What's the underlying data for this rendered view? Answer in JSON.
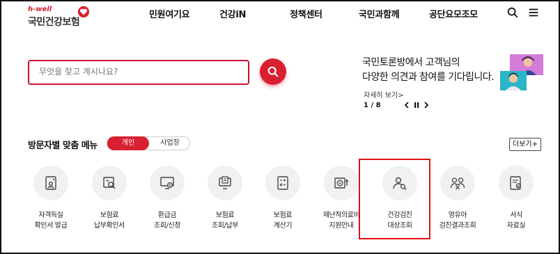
{
  "header": {
    "logo_small": "h-well",
    "logo_name": "국민건강보험",
    "nav": [
      "민원여기요",
      "건강iN",
      "정책센터",
      "국민과함께",
      "공단요모조모"
    ],
    "icons": [
      "search-icon",
      "hamburger-menu-icon"
    ]
  },
  "search": {
    "placeholder": "무엇을 찾고 계시나요?",
    "value": ""
  },
  "banner": {
    "line1": "국민토론방에서 고객님의",
    "line2": "다양한 의견과 참여를 기다립니다.",
    "more": "자세히 보기>",
    "page": "1 / 8",
    "controls": [
      "chevron-left-icon",
      "pause-icon",
      "chevron-right-icon"
    ]
  },
  "menu": {
    "title": "방문자별 맞춤 메뉴",
    "toggle_personal": "개인",
    "toggle_business": "사업장",
    "more": "더보기+",
    "highlighted_index": 6,
    "items": [
      {
        "line1": "자격득실",
        "line2": "확인서 발급",
        "icon": "id-card-heart-icon"
      },
      {
        "line1": "보험료",
        "line2": "납부확인서",
        "icon": "document-search-icon"
      },
      {
        "line1": "환급금",
        "line2": "조회/신청",
        "icon": "monitor-won-icon"
      },
      {
        "line1": "보험료",
        "line2": "조회/납부",
        "icon": "bill-monitor-icon"
      },
      {
        "line1": "보험료",
        "line2": "계산기",
        "icon": "calculator-icon"
      },
      {
        "line1": "재난적의료비",
        "line2": "지원안내",
        "icon": "won-support-icon"
      },
      {
        "line1": "건강검진",
        "line2": "대상조회",
        "icon": "person-search-icon"
      },
      {
        "line1": "영유아",
        "line2": "검진결과조회",
        "icon": "child-parents-icon"
      },
      {
        "line1": "서식",
        "line2": "자료실",
        "icon": "form-document-icon"
      }
    ]
  },
  "colors": {
    "brand_red": "#d9202f",
    "highlight_red": "#e01010"
  }
}
